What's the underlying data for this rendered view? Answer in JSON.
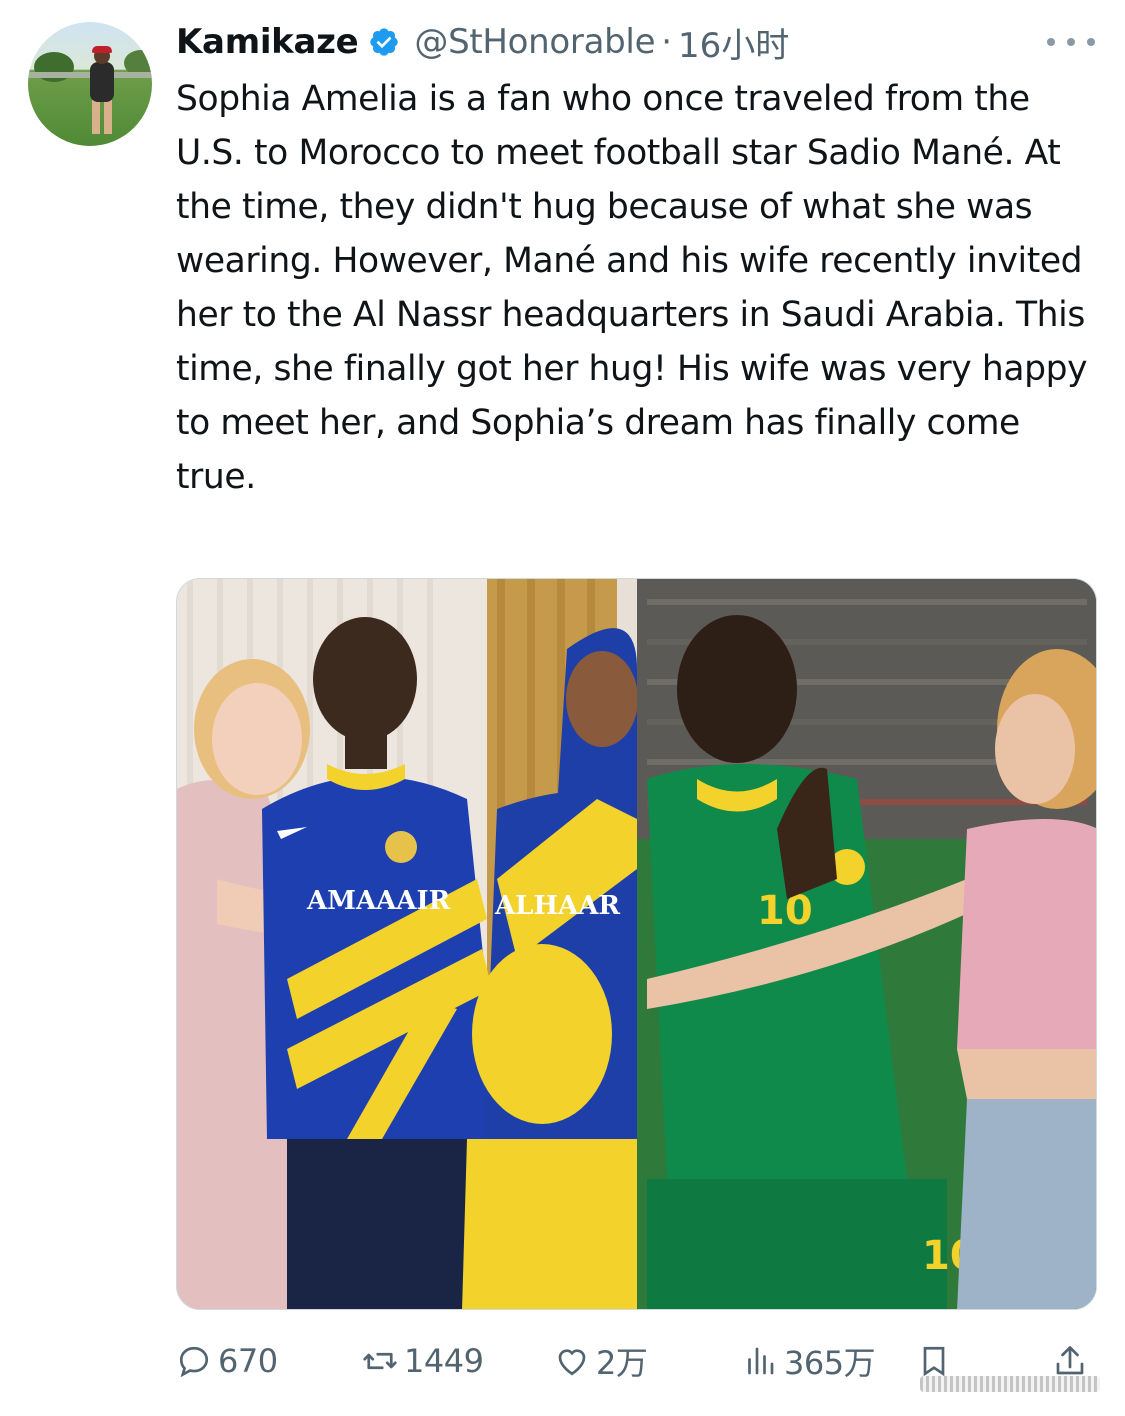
{
  "author": {
    "display_name": "Kamikaze",
    "handle": "@StHonorable",
    "separator": "·",
    "time": "16小时",
    "verified": true,
    "verified_color": "#1d9bf0"
  },
  "tweet": {
    "text": "Sophia Amelia is a fan who once traveled from the U.S. to Morocco to meet football star Sadio Mané. At the time, they didn't hug because of what she was wearing. However, Mané and his wife recently invited her to the Al Nassr headquarters in Saudi Arabia. This time, she finally got her hug! His wife was very happy to meet her, and Sophia’s dream has finally come true."
  },
  "media": {
    "left_jersey_text_1": "AMAAAIR",
    "left_jersey_text_2": "ALHAAR",
    "right_jersey_number_chest": "10",
    "right_jersey_number_shorts": "10"
  },
  "actions": {
    "replies": "670",
    "retweets": "1449",
    "likes": "2万",
    "views": "365万"
  },
  "icons": [
    "more-icon",
    "verified-badge-icon",
    "reply-icon",
    "retweet-icon",
    "like-icon",
    "views-icon",
    "bookmark-icon",
    "share-icon"
  ],
  "colors": {
    "text": "#0f1419",
    "secondary": "#536471",
    "accent": "#1d9bf0"
  }
}
